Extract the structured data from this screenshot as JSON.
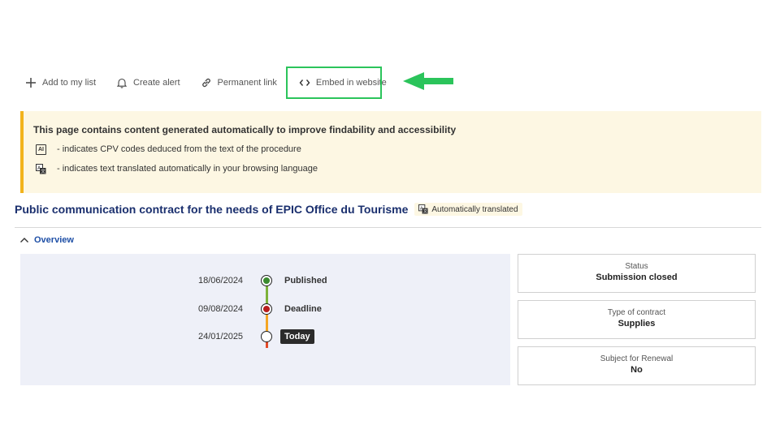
{
  "toolbar": {
    "items": [
      {
        "label": "Add to my list",
        "icon": "plus-icon"
      },
      {
        "label": "Create alert",
        "icon": "bell-icon"
      },
      {
        "label": "Permanent link",
        "icon": "link-icon"
      },
      {
        "label": "Embed in website",
        "icon": "code-icon"
      }
    ]
  },
  "notice": {
    "title": "This page contains content generated automatically to improve findability and accessibility",
    "rows": [
      {
        "badge": "AI",
        "text": "- indicates CPV codes deduced from the text of the procedure"
      },
      {
        "badge": "translate-icon",
        "text": "- indicates text translated automatically in your browsing language"
      }
    ]
  },
  "page": {
    "title": "Public communication contract for the needs of EPIC Office du Tourisme",
    "auto_tag": "Automatically translated"
  },
  "overview": {
    "label": "Overview"
  },
  "timeline": [
    {
      "date": "18/06/2024",
      "label": "Published",
      "color": "#3a8a2e"
    },
    {
      "date": "09/08/2024",
      "label": "Deadline",
      "color": "#b81d1d"
    },
    {
      "date": "24/01/2025",
      "label": "Today",
      "color": ""
    }
  ],
  "cards": [
    {
      "label": "Status",
      "value": "Submission closed"
    },
    {
      "label": "Type of contract",
      "value": "Supplies"
    },
    {
      "label": "Subject for Renewal",
      "value": "No"
    }
  ],
  "colors": {
    "highlight": "#2bc45b",
    "accent": "#1e4fa6",
    "notice_bg": "#fdf7e3",
    "notice_border": "#f2b31c"
  }
}
